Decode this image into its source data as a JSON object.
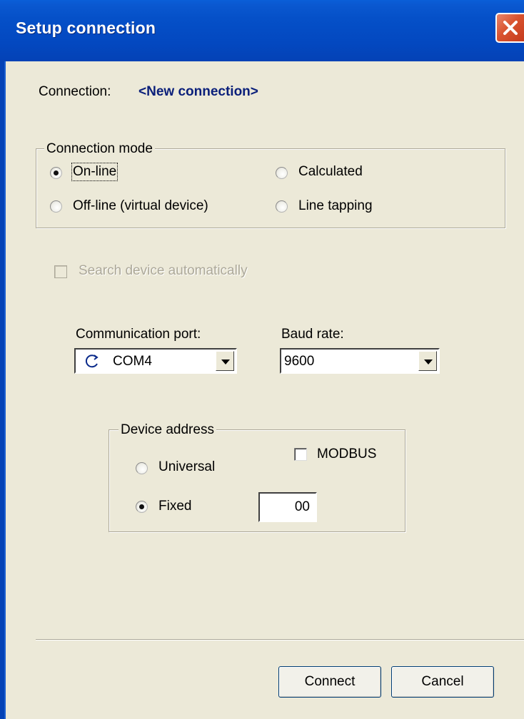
{
  "window": {
    "title": "Setup connection",
    "close_icon": "close-icon"
  },
  "connection": {
    "label": "Connection:",
    "name": "<New connection>"
  },
  "connection_mode": {
    "legend": "Connection mode",
    "options": {
      "online": "On-line",
      "calculated": "Calculated",
      "offline": "Off-line (virtual device)",
      "line_tapping": "Line tapping"
    },
    "selected": "On-line"
  },
  "search_device": {
    "label": "Search device automatically",
    "checked": false,
    "enabled": false
  },
  "communication_port": {
    "label": "Communication port:",
    "value": "COM4",
    "icon": "refresh-icon"
  },
  "baud_rate": {
    "label": "Baud rate:",
    "value": "9600"
  },
  "device_address": {
    "legend": "Device address",
    "universal": "Universal",
    "fixed": "Fixed",
    "selected": "Fixed",
    "modbus_label": "MODBUS",
    "modbus_checked": false,
    "address_value": "00"
  },
  "buttons": {
    "connect": "Connect",
    "cancel": "Cancel"
  },
  "colors": {
    "titlebar": "#0348c0",
    "dialog_bg": "#ece9d8",
    "connection_name": "#0a1f7a",
    "close_button": "#d9532f"
  }
}
